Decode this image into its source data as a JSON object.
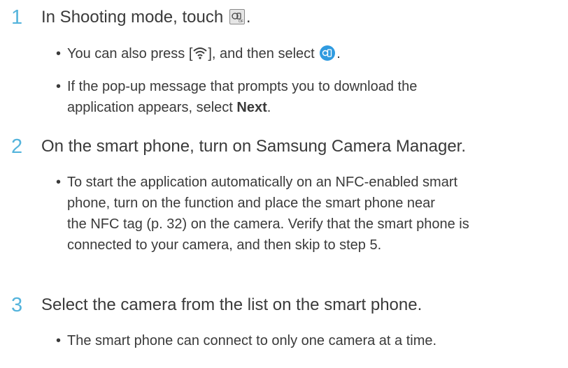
{
  "step1": {
    "number": "1",
    "text_before": "In Shooting mode, touch",
    "text_after": ".",
    "bullets": [
      {
        "before": "You can also press [",
        "middle": "], and then select",
        "after": "."
      },
      {
        "line1": "If the pop-up message that prompts you to download the",
        "line2_before": "application appears, select ",
        "line2_bold": "Next",
        "line2_after": "."
      }
    ]
  },
  "step2": {
    "number": "2",
    "text": "On the smart phone, turn on Samsung Camera Manager.",
    "bullet_lines": [
      "To start the application automatically on an NFC-enabled smart",
      "phone, turn on the function and place the smart phone near",
      "the NFC tag (p. 32) on the camera. Verify that the smart phone is",
      "connected to your camera, and then skip to step 5."
    ]
  },
  "step3": {
    "number": "3",
    "text": "Select the camera from the list on the smart phone.",
    "bullet": "The smart phone can connect to only one camera at a time."
  },
  "bullet_char": "•",
  "icons": {
    "mode_icon": "mobile-link-mode-icon",
    "wifi_icon": "wifi-icon",
    "phone_icon": "phone-link-icon"
  },
  "colors": {
    "step_number": "#55b4dc",
    "phone_icon_bg": "#2f9be0",
    "text": "#3a3a3a"
  }
}
